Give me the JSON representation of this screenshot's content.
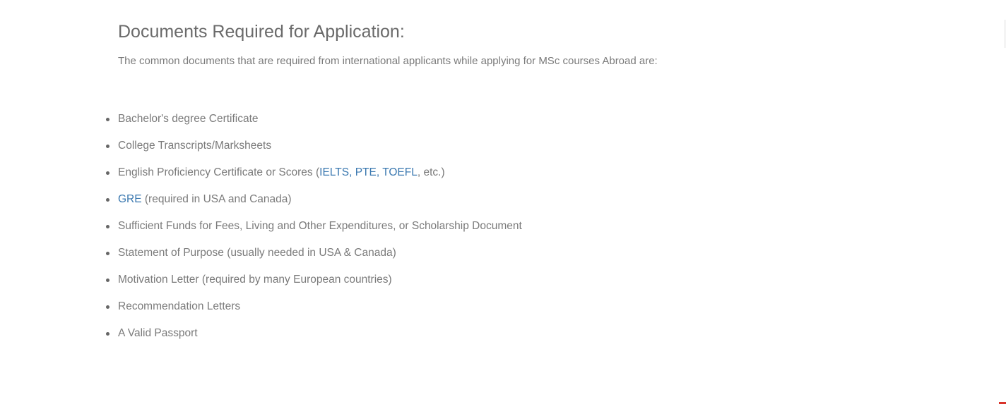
{
  "section": {
    "title": "Documents Required for Application:",
    "intro": "The common documents that are required from international applicants while applying for MSc courses Abroad are:"
  },
  "documents": {
    "item1": "Bachelor's degree Certificate",
    "item2": "College Transcripts/Marksheets",
    "item3": {
      "prefix": "English Proficiency Certificate or Scores (",
      "link_ielts": "IELTS",
      "sep1": ", ",
      "link_pte": "PTE",
      "sep2": ", ",
      "link_toefl": "TOEFL",
      "suffix": ", etc.)"
    },
    "item4": {
      "link_gre": "GRE",
      "suffix": " (required in USA and Canada)"
    },
    "item5": "Sufficient Funds for Fees, Living and Other Expenditures, or Scholarship Document",
    "item6": "Statement of Purpose (usually needed in USA & Canada)",
    "item7": "Motivation Letter (required by many European countries)",
    "item8": "Recommendation Letters",
    "item9": "A Valid Passport"
  },
  "colors": {
    "text": "#7a7a7a",
    "heading": "#6a6a6a",
    "link": "#3a78b0",
    "accent": "#d9342b"
  }
}
